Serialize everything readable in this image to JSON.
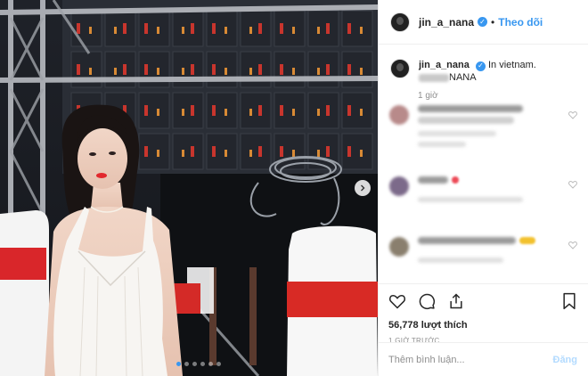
{
  "post": {
    "username": "jin_a_nana",
    "follow_label": "Theo dõi",
    "separator": "•",
    "verified_glyph": "✓",
    "caption_text": "In vietnam.",
    "caption_signature": "NANA",
    "caption_time": "1 giờ",
    "likes": "56,778 lượt thích",
    "time_ago": "1 GIỜ TRƯỚC",
    "comment_placeholder": "Thêm bình luận...",
    "post_label": "Đăng"
  },
  "carousel": {
    "slides": 6,
    "active_index": 0
  },
  "colors": {
    "accent": "#3897f0",
    "post_disabled": "#b3dbff",
    "heart_red": "#ed4956",
    "text_primary": "#262626",
    "text_secondary": "#8e8e8e"
  },
  "icons": [
    "verified-badge-icon",
    "heart-icon",
    "comment-icon",
    "share-icon",
    "bookmark-icon",
    "chevron-right-icon"
  ]
}
